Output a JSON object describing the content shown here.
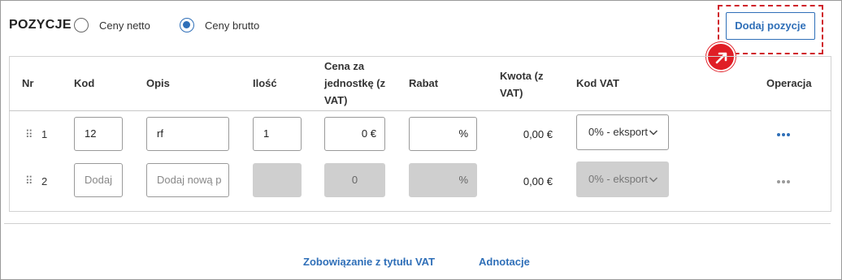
{
  "header": {
    "title": "POZYCJE",
    "radio_netto_label": "Ceny netto",
    "radio_brutto_label": "Ceny brutto",
    "selected_price_mode": "Ceny brutto",
    "add_button_label": "Dodaj pozycje"
  },
  "table": {
    "columns": {
      "nr": "Nr",
      "kod": "Kod",
      "opis": "Opis",
      "ilosc": "Ilość",
      "cena": "Cena za jednostkę (z VAT)",
      "rabat": "Rabat",
      "kwota": "Kwota (z VAT)",
      "kod_vat": "Kod VAT",
      "operacja": "Operacja"
    },
    "rows": [
      {
        "nr": "1",
        "kod": "12",
        "opis": "rf",
        "ilosc": "1",
        "cena": "0 €",
        "rabat": "%",
        "kwota": "0,00 €",
        "kod_vat": "0% - eksport"
      },
      {
        "nr": "2",
        "kod_placeholder": "Dodaj",
        "opis_placeholder": "Dodaj nową p",
        "ilosc": "",
        "cena": "0",
        "rabat": "%",
        "kwota": "0,00 €",
        "kod_vat": "0% - eksport"
      }
    ]
  },
  "footer": {
    "link_vat": "Zobowiązanie z tytułu VAT",
    "link_notes": "Adnotacje"
  },
  "colors": {
    "accent": "#2f6fb8",
    "highlight": "#d0242b",
    "disabled": "#cfcfcf"
  }
}
